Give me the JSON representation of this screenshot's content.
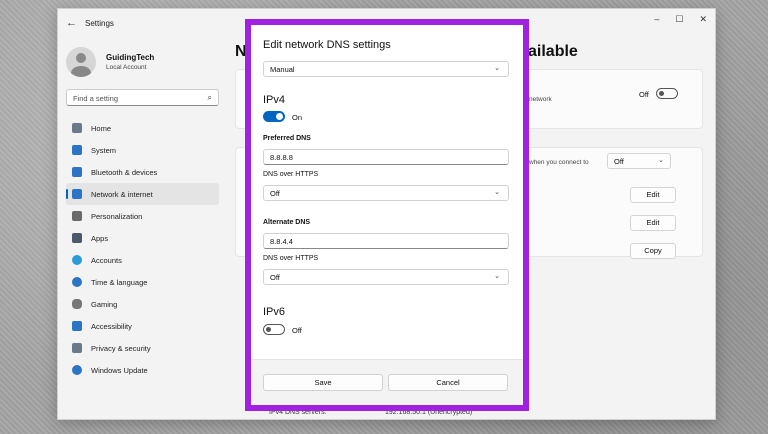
{
  "window": {
    "title": "Settings",
    "controls": [
      "–",
      "☐",
      "✕"
    ]
  },
  "profile": {
    "name": "GuidingTech",
    "account_type": "Local Account"
  },
  "search": {
    "placeholder": "Find a setting"
  },
  "sidebar": {
    "items": [
      {
        "label": "Home",
        "icon": "home-icon",
        "color": "#6b7a8a"
      },
      {
        "label": "System",
        "icon": "system-icon",
        "color": "#2c74c4"
      },
      {
        "label": "Bluetooth & devices",
        "icon": "bluetooth-icon",
        "color": "#2c74c4"
      },
      {
        "label": "Network & internet",
        "icon": "network-icon",
        "color": "#2c74c4"
      },
      {
        "label": "Personalization",
        "icon": "brush-icon",
        "color": "#6a6a6a"
      },
      {
        "label": "Apps",
        "icon": "apps-icon",
        "color": "#4a5a6a"
      },
      {
        "label": "Accounts",
        "icon": "accounts-icon",
        "color": "#2c9ad6"
      },
      {
        "label": "Time & language",
        "icon": "time-language-icon",
        "color": "#2c74c4"
      },
      {
        "label": "Gaming",
        "icon": "gaming-icon",
        "color": "#777777"
      },
      {
        "label": "Accessibility",
        "icon": "accessibility-icon",
        "color": "#2c74c4"
      },
      {
        "label": "Privacy & security",
        "icon": "shield-icon",
        "color": "#6b7a8a"
      },
      {
        "label": "Windows Update",
        "icon": "windows-update-icon",
        "color": "#2c74c4"
      }
    ],
    "active_index": 3
  },
  "background": {
    "heading_left": "N",
    "heading_right": "ailable",
    "network_text": "network",
    "toggle_label": "Off",
    "connect_text": "when you connect to",
    "select_value": "Off",
    "edit1": "Edit",
    "edit2": "Edit",
    "copy": "Copy",
    "ipv4_dns_label": "IPv4 DNS servers:",
    "ipv4_dns_value": "192.168.50.1 (Unencrypted)"
  },
  "dialog": {
    "title": "Edit network DNS settings",
    "mode": "Manual",
    "ipv4": {
      "title": "IPv4",
      "toggle_state": "On",
      "preferred_label": "Preferred DNS",
      "preferred_value": "8.8.8.8",
      "preferred_https_label": "DNS over HTTPS",
      "preferred_https_value": "Off",
      "alternate_label": "Alternate DNS",
      "alternate_value": "8.8.4.4",
      "alternate_https_label": "DNS over HTTPS",
      "alternate_https_value": "Off"
    },
    "ipv6": {
      "title": "IPv6",
      "toggle_state": "Off"
    },
    "save_label": "Save",
    "cancel_label": "Cancel"
  },
  "colors": {
    "accent": "#0067c0",
    "frame": "#a021e0"
  }
}
